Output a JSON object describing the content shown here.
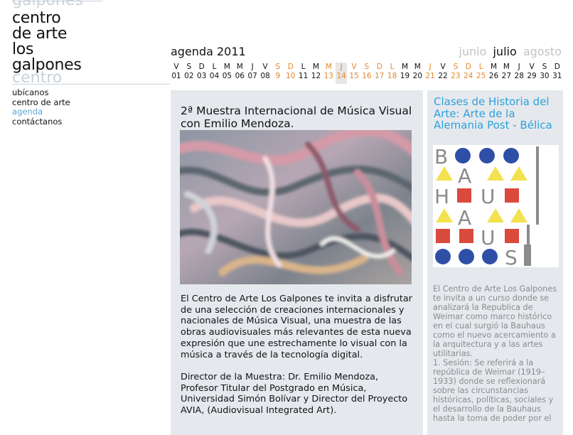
{
  "logo": {
    "ghost_top": "galpones",
    "lines": [
      "centro",
      "de arte",
      "los",
      "galpones"
    ],
    "ghost_bottom": "centro"
  },
  "nav": {
    "items": [
      {
        "label": "ubícanos",
        "active": false
      },
      {
        "label": "centro de arte",
        "active": false
      },
      {
        "label": "agenda",
        "active": true
      },
      {
        "label": "contáctanos",
        "active": false
      }
    ]
  },
  "agenda": {
    "title": "agenda 2011",
    "months": {
      "prev": "junio",
      "current": "julio",
      "next": "agosto"
    },
    "days": [
      {
        "w": "V",
        "d": "01",
        "we": false
      },
      {
        "w": "S",
        "d": "02",
        "we": false
      },
      {
        "w": "D",
        "d": "03",
        "we": false
      },
      {
        "w": "L",
        "d": "04",
        "we": false
      },
      {
        "w": "M",
        "d": "05",
        "we": false
      },
      {
        "w": "M",
        "d": "06",
        "we": false
      },
      {
        "w": "J",
        "d": "07",
        "we": false
      },
      {
        "w": "V",
        "d": "08",
        "we": false
      },
      {
        "w": "S",
        "d": "9",
        "we": true
      },
      {
        "w": "D",
        "d": "10",
        "we": true
      },
      {
        "w": "L",
        "d": "11",
        "we": false
      },
      {
        "w": "M",
        "d": "12",
        "we": false
      },
      {
        "w": "M",
        "d": "13",
        "we": true
      },
      {
        "w": "J",
        "d": "14",
        "we": true,
        "today": true
      },
      {
        "w": "V",
        "d": "15",
        "we": true
      },
      {
        "w": "S",
        "d": "16",
        "we": true
      },
      {
        "w": "D",
        "d": "17",
        "we": true
      },
      {
        "w": "L",
        "d": "18",
        "we": true
      },
      {
        "w": "M",
        "d": "19",
        "we": false
      },
      {
        "w": "M",
        "d": "20",
        "we": false
      },
      {
        "w": "J",
        "d": "21",
        "we": true
      },
      {
        "w": "V",
        "d": "22",
        "we": false
      },
      {
        "w": "S",
        "d": "23",
        "we": true
      },
      {
        "w": "D",
        "d": "24",
        "we": true
      },
      {
        "w": "L",
        "d": "25",
        "we": true
      },
      {
        "w": "M",
        "d": "26",
        "we": false
      },
      {
        "w": "M",
        "d": "27",
        "we": false
      },
      {
        "w": "J",
        "d": "28",
        "we": false
      },
      {
        "w": "V",
        "d": "29",
        "we": false
      },
      {
        "w": "S",
        "d": "30",
        "we": false
      },
      {
        "w": "D",
        "d": "31",
        "we": false
      }
    ]
  },
  "event": {
    "title": "2ª Muestra Internacional de Música Visual con Emilio Mendoza.",
    "paragraphs": [
      "El Centro de Arte Los Galpones te invita a disfrutar de una selección de creaciones internacionales y nacionales de Música Visual, una muestra de las obras audiovisuales más relevantes de esta nueva expresión que une estrechamente lo visual con la música a través de la tecnología digital.",
      "Director de la Muestra: Dr. Emilio Mendoza, Profesor Titular del Postgrado en Música, Universidad Simón Bolívar y Director del Proyecto AVIA, (Audiovisual Integrated Art)."
    ]
  },
  "side": {
    "title": "Clases de Historia del Arte: Arte de la Alemania Post - Bélica",
    "poster_letters": [
      "B",
      "A",
      "H",
      "U",
      "A",
      "U",
      "S"
    ],
    "paragraphs": [
      "El Centro de Arte Los Galpones te invita a un curso donde se analizará la Republica de Weimar como marco histórico en el cual surgió la Bauhaus como el nuevo acercamiento a la arquitectura y a las artes utilitarias.",
      "1. Sesión: Se referirá a la república de Weimar (1919–1933) donde se reflexionará sobre las circunstancias históricas, políticas, sociales y el desarrollo de la Bauhaus hasta la toma de poder por el"
    ]
  },
  "colors": {
    "accent_blue": "#2ea0d8",
    "nav_active": "#5aa8d6",
    "weekend_orange": "#e08a2c",
    "card_bg": "#e5e9ee",
    "ghost_text": "#c9d2dc"
  }
}
